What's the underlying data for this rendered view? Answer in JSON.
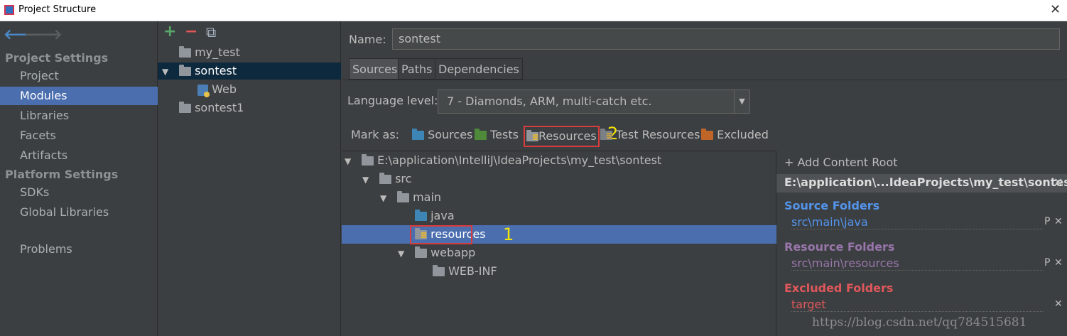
{
  "window": {
    "title": "Project Structure",
    "close": "✕"
  },
  "nav": {
    "back": "🡐",
    "forward": "🡒",
    "sections": [
      {
        "header": "Project Settings",
        "items": [
          "Project",
          "Modules",
          "Libraries",
          "Facets",
          "Artifacts"
        ]
      },
      {
        "header": "Platform Settings",
        "items": [
          "SDKs",
          "Global Libraries"
        ]
      }
    ],
    "problems": "Problems",
    "selected": "Modules"
  },
  "toolbar": {
    "add": "+",
    "remove": "−",
    "copy": "⧉"
  },
  "modules": {
    "items": [
      {
        "label": "my_test"
      },
      {
        "label": "sontest",
        "expanded": "▼"
      },
      {
        "label": "Web"
      },
      {
        "label": "sontest1"
      }
    ]
  },
  "main": {
    "name_label": "Name:",
    "name_value": "sontest",
    "tabs": [
      "Sources",
      "Paths",
      "Dependencies"
    ],
    "language_level_label": "Language level:",
    "language_level_value": "7 - Diamonds, ARM, multi-catch etc.",
    "mark_as_label": "Mark as:",
    "mark_as": [
      "Sources",
      "Tests",
      "Resources",
      "Test Resources",
      "Excluded"
    ]
  },
  "tree": {
    "root": "E:\\application\\IntelliJ\\IdeaProjects\\my_test\\sontest",
    "src": "src",
    "main": "main",
    "java": "java",
    "resources": "resources",
    "webapp": "webapp",
    "webinf": "WEB-INF"
  },
  "content_root": {
    "add_label": "+ Add Content Root",
    "path": "E:\\application\\...IdeaProjects\\my_test\\sontest",
    "close": "✕",
    "source_title": "Source Folders",
    "source_path": "src\\main\\java",
    "resource_title": "Resource Folders",
    "resource_path": "src\\main\\resources",
    "excluded_title": "Excluded Folders",
    "excluded_path": "target",
    "prop_glyph": "P",
    "remove_glyph": "✕"
  },
  "annotations": {
    "one": "1",
    "two": "2"
  },
  "watermark": "https://blog.csdn.net/qq784515681",
  "colors": {
    "source": "#5394ec",
    "resource": "#9876aa",
    "excluded": "#e0575b",
    "selection": "#4b6eaf",
    "highlight_box": "#d93c3c",
    "annotation": "#f5e400"
  }
}
